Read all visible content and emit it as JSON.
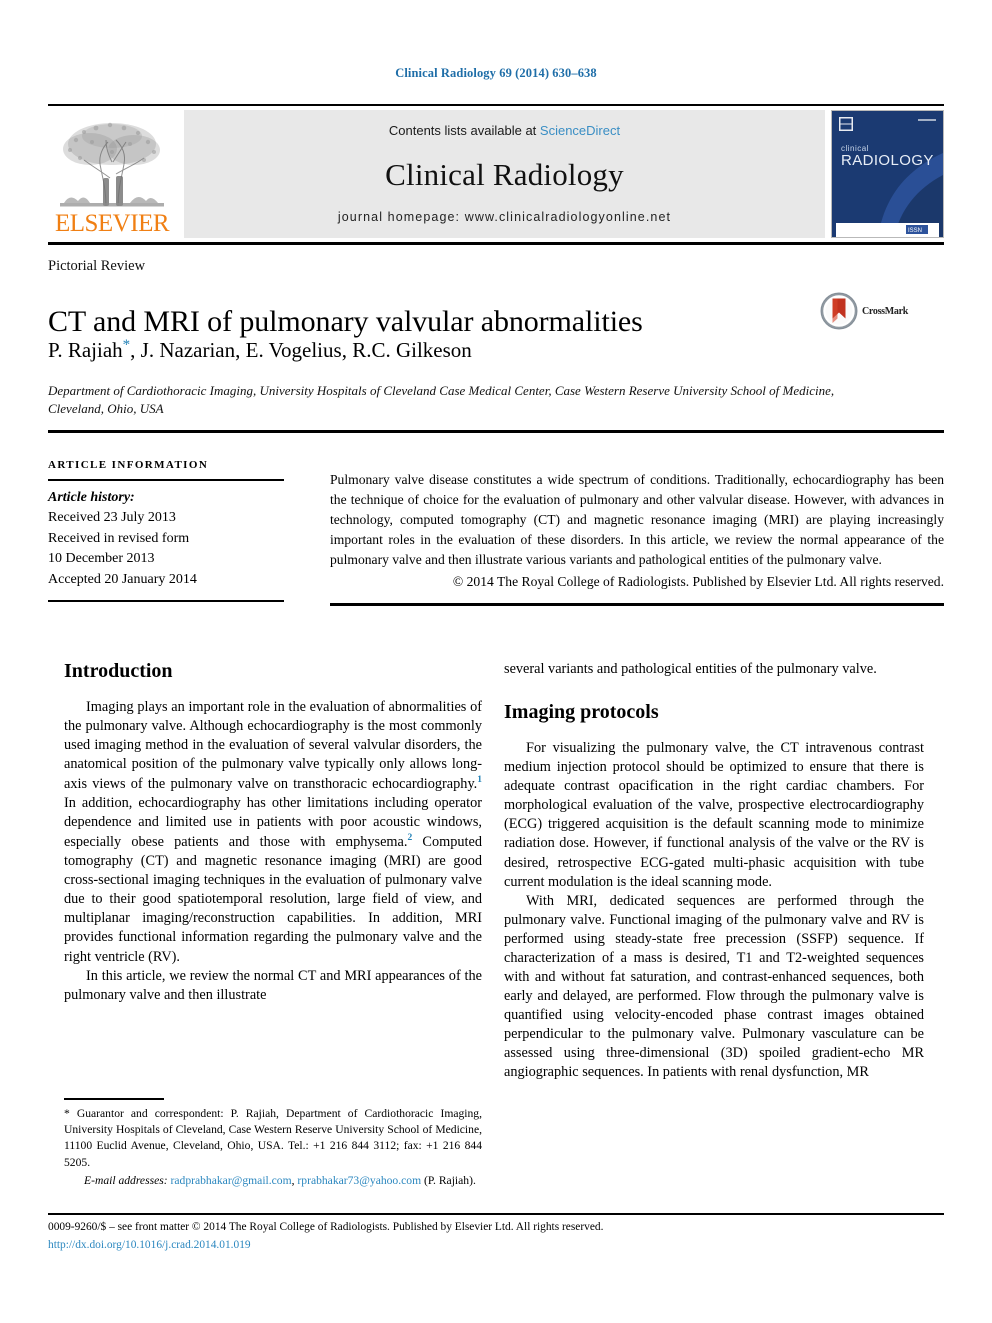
{
  "running_head": "Clinical Radiology 69 (2014) 630–638",
  "masthead": {
    "publisher_logo_text": "ELSEVIER",
    "contents_prefix": "Contents lists available at ",
    "contents_link": "ScienceDirect",
    "journal_name": "Clinical Radiology",
    "homepage_line": "journal homepage: www.clinicalradiologyonline.net",
    "cover": {
      "title_small": "clinical",
      "title_large": "RADIOLOGY",
      "accent_color": "#1b3a72",
      "issn_badge": "ISSN"
    }
  },
  "article": {
    "type": "Pictorial Review",
    "title": "CT and MRI of pulmonary valvular abnormalities",
    "crossmark_label": "CrossMark",
    "authors": "P. Rajiah",
    "authors_rest": ", J. Nazarian, E. Vogelius, R.C. Gilkeson",
    "affiliation": "Department of Cardiothoracic Imaging, University Hospitals of Cleveland Case Medical Center, Case Western Reserve University School of Medicine, Cleveland, Ohio, USA"
  },
  "article_info": {
    "heading": "ARTICLE INFORMATION",
    "history_label": "Article history:",
    "received": "Received 23 July 2013",
    "revised_label": "Received in revised form",
    "revised_date": "10 December 2013",
    "accepted": "Accepted 20 January 2014"
  },
  "abstract": {
    "text": "Pulmonary valve disease constitutes a wide spectrum of conditions. Traditionally, echocardiography has been the technique of choice for the evaluation of pulmonary and other valvular disease. However, with advances in technology, computed tomography (CT) and magnetic resonance imaging (MRI) are playing increasingly important roles in the evaluation of these disorders. In this article, we review the normal appearance of the pulmonary valve and then illustrate various variants and pathological entities of the pulmonary valve.",
    "copyright": "© 2014 The Royal College of Radiologists. Published by Elsevier Ltd. All rights reserved."
  },
  "body": {
    "left": {
      "intro_heading": "Introduction",
      "p1_a": "Imaging plays an important role in the evaluation of abnormalities of the pulmonary valve. Although echocardiography is the most commonly used imaging method in the evaluation of several valvular disorders, the anatomical position of the pulmonary valve typically only allows long-axis views of the pulmonary valve on transthoracic echocardiography.",
      "ref1": "1",
      "p1_b": " In addition, echocardiography has other limitations including operator dependence and limited use in patients with poor acoustic windows, especially obese patients and those with emphysema.",
      "ref2": "2",
      "p1_c": " Computed tomography (CT) and magnetic resonance imaging (MRI) are good cross-sectional imaging techniques in the evaluation of pulmonary valve due to their good spatiotemporal resolution, large field of view, and multiplanar imaging/reconstruction capabilities. In addition, MRI provides functional information regarding the pulmonary valve and the right ventricle (RV).",
      "p2": "In this article, we review the normal CT and MRI appearances of the pulmonary valve and then illustrate"
    },
    "right": {
      "cont": "several variants and pathological entities of the pulmonary valve.",
      "protocols_heading": "Imaging protocols",
      "p1": "For visualizing the pulmonary valve, the CT intravenous contrast medium injection protocol should be optimized to ensure that there is adequate contrast opacification in the right cardiac chambers. For morphological evaluation of the valve, prospective electrocardiography (ECG) triggered acquisition is the default scanning mode to minimize radiation dose. However, if functional analysis of the valve or the RV is desired, retrospective ECG-gated multi-phasic acquisition with tube current modulation is the ideal scanning mode.",
      "p2": "With MRI, dedicated sequences are performed through the pulmonary valve. Functional imaging of the pulmonary valve and RV is performed using steady-state free precession (SSFP) sequence. If characterization of a mass is desired, T1 and T2-weighted sequences with and without fat saturation, and contrast-enhanced sequences, both early and delayed, are performed. Flow through the pulmonary valve is quantified using velocity-encoded phase contrast images obtained perpendicular to the pulmonary valve. Pulmonary vasculature can be assessed using three-dimensional (3D) spoiled gradient-echo MR angiographic sequences. In patients with renal dysfunction, MR"
    }
  },
  "footnote": {
    "text": "* Guarantor and correspondent: P. Rajiah, Department of Cardiothoracic Imaging, University Hospitals of Cleveland, Case Western Reserve University School of Medicine, 11100 Euclid Avenue, Cleveland, Ohio, USA. Tel.: +1 216 844 3112; fax: +1 216 844 5205.",
    "email_label": "E-mail addresses:",
    "email1": "radprabhakar@gmail.com",
    "email2": "rprabhakar73@yahoo.com",
    "email_suffix": "(P. Rajiah)."
  },
  "footer": {
    "issn_line": "0009-9260/$ – see front matter © 2014 The Royal College of Radiologists. Published by Elsevier Ltd. All rights reserved.",
    "doi": "http://dx.doi.org/10.1016/j.crad.2014.01.019"
  },
  "colors": {
    "link_blue": "#2b87bf",
    "elsevier_orange": "#f07f13",
    "cover_blue": "#1b3a72",
    "ref_blue": "#1f7fb5"
  }
}
